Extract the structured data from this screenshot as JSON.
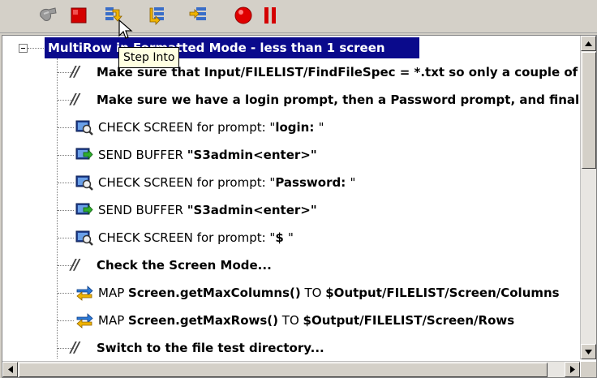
{
  "toolbar": {
    "buttons": [
      {
        "name": "disconnect-button",
        "icon": "disconnect-icon"
      },
      {
        "name": "stop-button",
        "icon": "stop-icon"
      },
      {
        "name": "step-into-button",
        "icon": "step-into-icon"
      },
      {
        "name": "step-over-button",
        "icon": "step-over-icon"
      },
      {
        "name": "step-out-button",
        "icon": "step-out-icon"
      },
      {
        "name": "record-button",
        "icon": "record-icon"
      },
      {
        "name": "pause-button",
        "icon": "pause-icon"
      }
    ],
    "tooltip": "Step Into"
  },
  "tree": {
    "root_label": "MultiRow in Formatted Mode - less than 1 screen",
    "rows": [
      {
        "type": "comment",
        "text": "Make sure that Input/FILELIST/FindFileSpec = *.txt so only a couple of f"
      },
      {
        "type": "comment",
        "text": "Make sure we have a login prompt, then a Password prompt, and final"
      },
      {
        "type": "check",
        "prefix": "CHECK SCREEN for prompt: \"",
        "bold": "login: ",
        "suffix": "\""
      },
      {
        "type": "send",
        "prefix": "SEND BUFFER ",
        "bold": "\"S3admin<enter>\"",
        "suffix": ""
      },
      {
        "type": "check",
        "prefix": "CHECK SCREEN for prompt: \"",
        "bold": "Password: ",
        "suffix": "\""
      },
      {
        "type": "send",
        "prefix": "SEND BUFFER ",
        "bold": "\"S3admin<enter>\"",
        "suffix": ""
      },
      {
        "type": "check",
        "prefix": "CHECK SCREEN for prompt: \"",
        "bold": "$ ",
        "suffix": "\""
      },
      {
        "type": "comment",
        "text": "Check the Screen Mode..."
      },
      {
        "type": "map",
        "prefix": "MAP ",
        "bold": "Screen.getMaxColumns()",
        "mid": " TO ",
        "bold2": "$Output/FILELIST/Screen/Columns"
      },
      {
        "type": "map",
        "prefix": "MAP ",
        "bold": "Screen.getMaxRows()",
        "mid": " TO ",
        "bold2": "$Output/FILELIST/Screen/Rows"
      },
      {
        "type": "comment",
        "text": "Switch to the file test directory..."
      }
    ]
  },
  "colors": {
    "selection": "#0a0a8c",
    "stop": "#d40000",
    "record": "#e00000",
    "tooltip_bg": "#ffffe1"
  }
}
